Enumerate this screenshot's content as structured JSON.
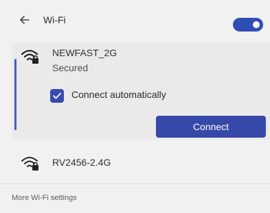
{
  "header": {
    "back_icon": "back-arrow-icon",
    "title": "Wi-Fi",
    "wifi_toggle": {
      "state": "on",
      "color": "#2f4eb5"
    }
  },
  "networks": [
    {
      "name": "NEWFAST_2G",
      "status": "Secured",
      "icon": "wifi-secured-icon",
      "expanded": true,
      "connect_automatically": {
        "label": "Connect automatically",
        "checked": true
      },
      "connect_button": "Connect"
    },
    {
      "name": "RV2456-2.4G",
      "icon": "wifi-secured-icon",
      "expanded": false
    }
  ],
  "footer": {
    "more_settings": "More Wi-Fi settings"
  },
  "colors": {
    "accent": "#3749a8",
    "toggle": "#2f4eb5",
    "background": "#f1f1f1"
  }
}
